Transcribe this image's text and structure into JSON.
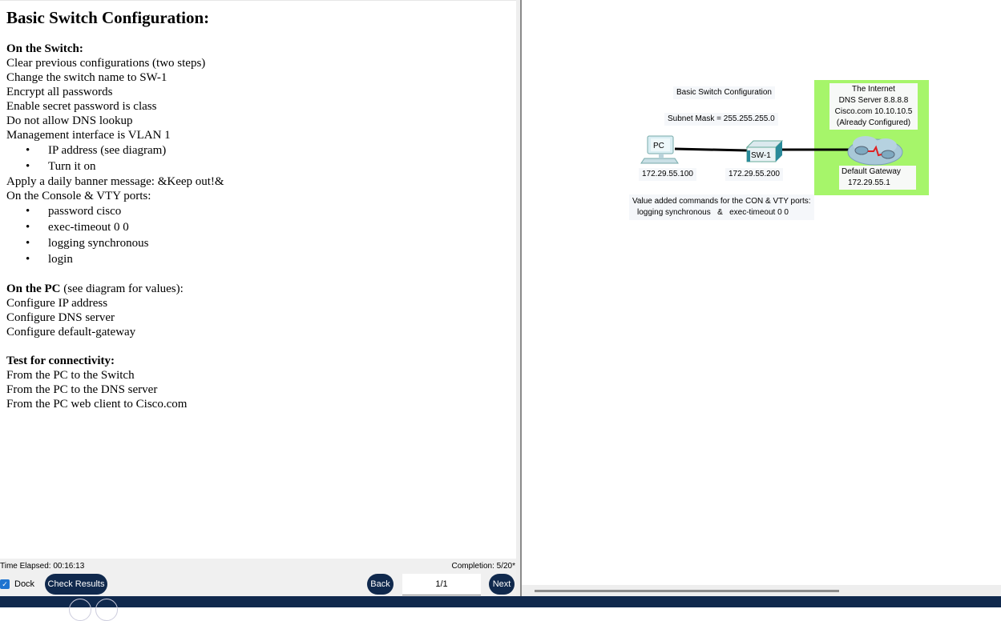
{
  "instructions": {
    "title": "Basic Switch Configuration:",
    "switch_section": {
      "title": "On the Switch:",
      "lines": [
        "Clear previous configurations (two steps)",
        "Change the switch name to SW-1",
        "Encrypt all passwords",
        "Enable secret password is class",
        "Do not allow DNS lookup",
        "Management interface is VLAN 1"
      ],
      "vlan_bullets": [
        "IP address (see diagram)",
        "Turn it on"
      ],
      "banner_line": "Apply a daily banner message: &Keep out!&",
      "console_line": "On the Console & VTY ports:",
      "console_bullets": [
        "password cisco",
        "exec-timeout 0 0",
        "logging synchronous",
        "login"
      ]
    },
    "pc_section": {
      "title": "On the PC",
      "title_suffix": " (see diagram for values):",
      "lines": [
        "Configure IP address",
        "Configure DNS server",
        "Configure default-gateway"
      ]
    },
    "test_section": {
      "title": "Test for connectivity:",
      "lines": [
        "From the PC to the Switch",
        "From the PC to the DNS server",
        "From the PC web client to Cisco.com"
      ]
    },
    "bullet_glyph": "•"
  },
  "controls": {
    "time_elapsed": "Time Elapsed: 00:16:13",
    "completion": "Completion: 5/20*",
    "dock_label": "Dock",
    "dock_checked": true,
    "check_results_label": "Check Results",
    "back_label": "Back",
    "page_value": "1/1",
    "next_label": "Next"
  },
  "diagram": {
    "title_label": "Basic Switch Configuration",
    "subnet_label": "Subnet Mask = 255.255.255.0",
    "pc": {
      "name": "PC",
      "ip": "172.29.55.100"
    },
    "switch": {
      "name": "SW-1",
      "ip": "172.29.55.200"
    },
    "internet": {
      "lines": [
        "The Internet",
        "DNS Server 8.8.8.8",
        "Cisco.com 10.10.10.5",
        "(Already Configured)"
      ],
      "color": "#a6f56a"
    },
    "gateway": {
      "line1": "Default Gateway",
      "line2": "172.29.55.1"
    },
    "value_added": {
      "line1": "Value added commands for the CON & VTY ports:",
      "line2": "logging synchronous   &   exec-timeout 0 0"
    }
  },
  "colors": {
    "accent": "#10294d",
    "checkbox": "#1e74d0"
  }
}
